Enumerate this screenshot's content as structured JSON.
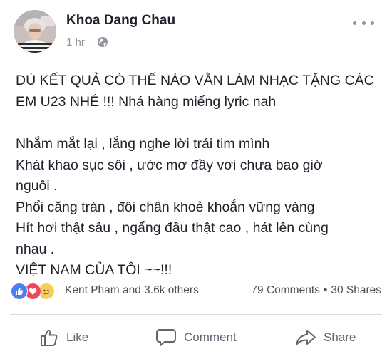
{
  "post": {
    "author": "Khoa Dang Chau",
    "time": "1 hr",
    "privacy_icon": "globe-icon",
    "more_icon": "more-dots-icon",
    "lines": [
      "DÙ KẾT QUẢ CÓ THẾ NÀO VẪN LÀM NHẠC TẶNG CÁC",
      "EM U23 NHÉ !!! Nhá hàng miếng lyric nah",
      "",
      "Nhắm mắt lại , lắng nghe lời trái tim mình",
      "Khát khao sục sôi , ước mơ đầy vơi chưa bao giờ",
      "nguôi .",
      "Phổi căng tràn , đôi chân khoẻ khoắn vững vàng",
      "Hít hơi thật sâu , ngẩng đầu thật cao , hát lên cùng",
      "nhau .",
      "VIỆT NAM CỦA TÔI ~~!!!"
    ]
  },
  "reactions": {
    "icons": [
      "like-reaction-icon",
      "love-reaction-icon",
      "sad-reaction-icon"
    ],
    "names": "Kent Pham and 3.6k others",
    "comments": "79 Comments",
    "separator": "•",
    "shares": "30 Shares"
  },
  "actions": {
    "like": "Like",
    "comment": "Comment",
    "share": "Share"
  },
  "colors": {
    "text": "#1d2129",
    "meta": "#90949c",
    "like_blue": "#4a7ef2",
    "love_red": "#f0465c",
    "sad_yellow": "#f7cf52"
  }
}
